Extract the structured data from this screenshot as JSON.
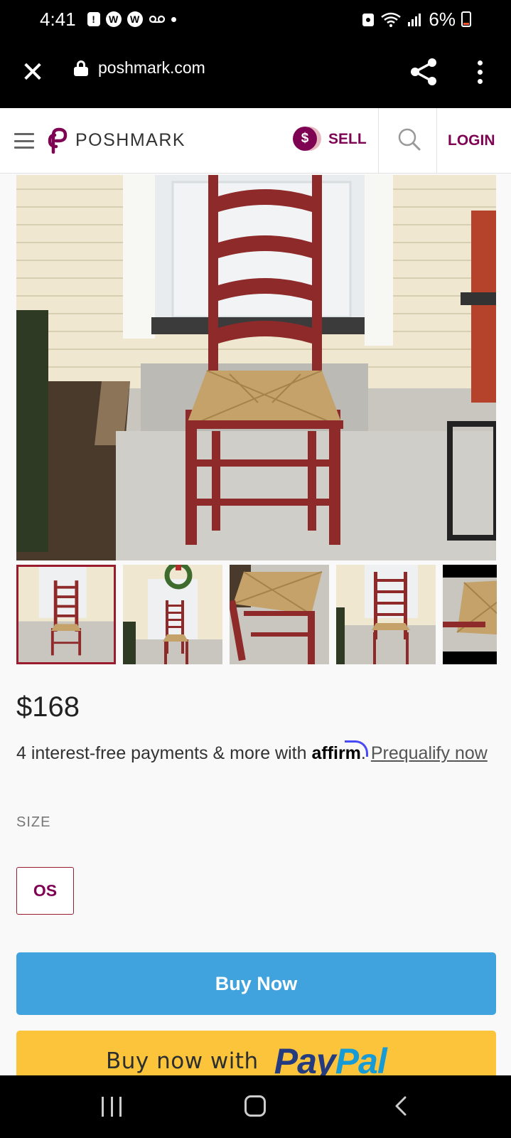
{
  "status_bar": {
    "time": "4:41",
    "battery": "6%"
  },
  "browser": {
    "url": "poshmark.com"
  },
  "header": {
    "logo": "POSHMARK",
    "sell_label": "SELL",
    "sell_coin": "$",
    "login_label": "LOGIN"
  },
  "listing": {
    "price": "$168",
    "affirm_prefix": "4 interest-free payments & more with",
    "affirm_logo": "affirm",
    "affirm_suffix": ".",
    "prequalify_word1": "Prequalify",
    "prequalify_word2": "now",
    "size_label": "SIZE",
    "size_value": "OS",
    "selected_thumbnail_index": 0
  },
  "actions": {
    "buy_now_label": "Buy Now",
    "paypal_prefix": "Buy now with",
    "paypal_logo_a": "Pay",
    "paypal_logo_b": "Pal"
  },
  "colors": {
    "brand": "#7f0353",
    "buy_now": "#41a3dd",
    "paypal": "#fbc43a",
    "thumb_selected": "#9a1b2e"
  }
}
